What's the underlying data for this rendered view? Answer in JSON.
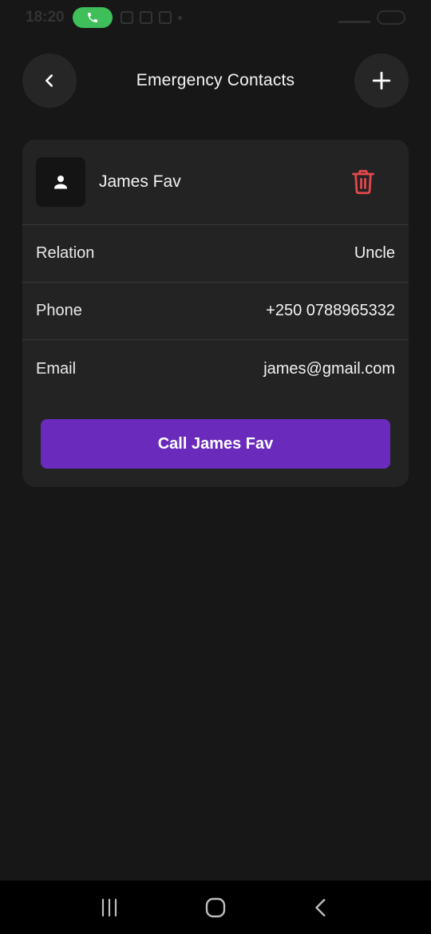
{
  "status_bar": {
    "time": "18:20"
  },
  "header": {
    "title": "Emergency Contacts",
    "back_icon": "chevron-left-icon",
    "add_icon": "plus-icon"
  },
  "contact": {
    "name": "James Fav",
    "rows": [
      {
        "label": "Relation",
        "value": "Uncle"
      },
      {
        "label": "Phone",
        "value": "+250 0788965332"
      },
      {
        "label": "Email",
        "value": "james@gmail.com"
      }
    ],
    "call_label": "Call James Fav"
  },
  "colors": {
    "background": "#171717",
    "card": "#232323",
    "accent": "#6a2bbd",
    "delete": "#e5484d",
    "call_pill": "#3fbf5a"
  }
}
